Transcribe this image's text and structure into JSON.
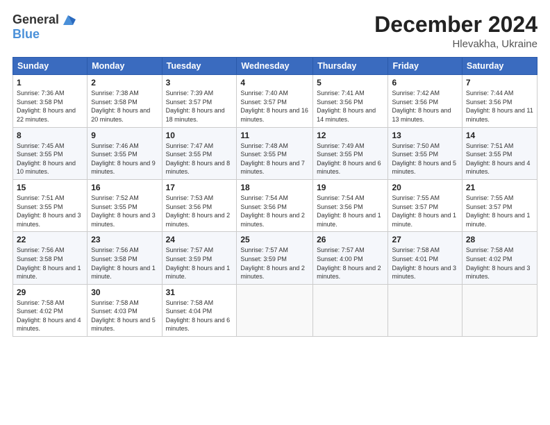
{
  "header": {
    "logo_general": "General",
    "logo_blue": "Blue",
    "title": "December 2024",
    "location": "Hlevakha, Ukraine"
  },
  "columns": [
    "Sunday",
    "Monday",
    "Tuesday",
    "Wednesday",
    "Thursday",
    "Friday",
    "Saturday"
  ],
  "weeks": [
    [
      {
        "day": "1",
        "sunrise": "7:36 AM",
        "sunset": "3:58 PM",
        "daylight": "8 hours and 22 minutes."
      },
      {
        "day": "2",
        "sunrise": "7:38 AM",
        "sunset": "3:58 PM",
        "daylight": "8 hours and 20 minutes."
      },
      {
        "day": "3",
        "sunrise": "7:39 AM",
        "sunset": "3:57 PM",
        "daylight": "8 hours and 18 minutes."
      },
      {
        "day": "4",
        "sunrise": "7:40 AM",
        "sunset": "3:57 PM",
        "daylight": "8 hours and 16 minutes."
      },
      {
        "day": "5",
        "sunrise": "7:41 AM",
        "sunset": "3:56 PM",
        "daylight": "8 hours and 14 minutes."
      },
      {
        "day": "6",
        "sunrise": "7:42 AM",
        "sunset": "3:56 PM",
        "daylight": "8 hours and 13 minutes."
      },
      {
        "day": "7",
        "sunrise": "7:44 AM",
        "sunset": "3:56 PM",
        "daylight": "8 hours and 11 minutes."
      }
    ],
    [
      {
        "day": "8",
        "sunrise": "7:45 AM",
        "sunset": "3:55 PM",
        "daylight": "8 hours and 10 minutes."
      },
      {
        "day": "9",
        "sunrise": "7:46 AM",
        "sunset": "3:55 PM",
        "daylight": "8 hours and 9 minutes."
      },
      {
        "day": "10",
        "sunrise": "7:47 AM",
        "sunset": "3:55 PM",
        "daylight": "8 hours and 8 minutes."
      },
      {
        "day": "11",
        "sunrise": "7:48 AM",
        "sunset": "3:55 PM",
        "daylight": "8 hours and 7 minutes."
      },
      {
        "day": "12",
        "sunrise": "7:49 AM",
        "sunset": "3:55 PM",
        "daylight": "8 hours and 6 minutes."
      },
      {
        "day": "13",
        "sunrise": "7:50 AM",
        "sunset": "3:55 PM",
        "daylight": "8 hours and 5 minutes."
      },
      {
        "day": "14",
        "sunrise": "7:51 AM",
        "sunset": "3:55 PM",
        "daylight": "8 hours and 4 minutes."
      }
    ],
    [
      {
        "day": "15",
        "sunrise": "7:51 AM",
        "sunset": "3:55 PM",
        "daylight": "8 hours and 3 minutes."
      },
      {
        "day": "16",
        "sunrise": "7:52 AM",
        "sunset": "3:55 PM",
        "daylight": "8 hours and 3 minutes."
      },
      {
        "day": "17",
        "sunrise": "7:53 AM",
        "sunset": "3:56 PM",
        "daylight": "8 hours and 2 minutes."
      },
      {
        "day": "18",
        "sunrise": "7:54 AM",
        "sunset": "3:56 PM",
        "daylight": "8 hours and 2 minutes."
      },
      {
        "day": "19",
        "sunrise": "7:54 AM",
        "sunset": "3:56 PM",
        "daylight": "8 hours and 1 minute."
      },
      {
        "day": "20",
        "sunrise": "7:55 AM",
        "sunset": "3:57 PM",
        "daylight": "8 hours and 1 minute."
      },
      {
        "day": "21",
        "sunrise": "7:55 AM",
        "sunset": "3:57 PM",
        "daylight": "8 hours and 1 minute."
      }
    ],
    [
      {
        "day": "22",
        "sunrise": "7:56 AM",
        "sunset": "3:58 PM",
        "daylight": "8 hours and 1 minute."
      },
      {
        "day": "23",
        "sunrise": "7:56 AM",
        "sunset": "3:58 PM",
        "daylight": "8 hours and 1 minute."
      },
      {
        "day": "24",
        "sunrise": "7:57 AM",
        "sunset": "3:59 PM",
        "daylight": "8 hours and 1 minute."
      },
      {
        "day": "25",
        "sunrise": "7:57 AM",
        "sunset": "3:59 PM",
        "daylight": "8 hours and 2 minutes."
      },
      {
        "day": "26",
        "sunrise": "7:57 AM",
        "sunset": "4:00 PM",
        "daylight": "8 hours and 2 minutes."
      },
      {
        "day": "27",
        "sunrise": "7:58 AM",
        "sunset": "4:01 PM",
        "daylight": "8 hours and 3 minutes."
      },
      {
        "day": "28",
        "sunrise": "7:58 AM",
        "sunset": "4:02 PM",
        "daylight": "8 hours and 3 minutes."
      }
    ],
    [
      {
        "day": "29",
        "sunrise": "7:58 AM",
        "sunset": "4:02 PM",
        "daylight": "8 hours and 4 minutes."
      },
      {
        "day": "30",
        "sunrise": "7:58 AM",
        "sunset": "4:03 PM",
        "daylight": "8 hours and 5 minutes."
      },
      {
        "day": "31",
        "sunrise": "7:58 AM",
        "sunset": "4:04 PM",
        "daylight": "8 hours and 6 minutes."
      },
      null,
      null,
      null,
      null
    ]
  ],
  "labels": {
    "sunrise": "Sunrise:",
    "sunset": "Sunset:",
    "daylight": "Daylight:"
  }
}
